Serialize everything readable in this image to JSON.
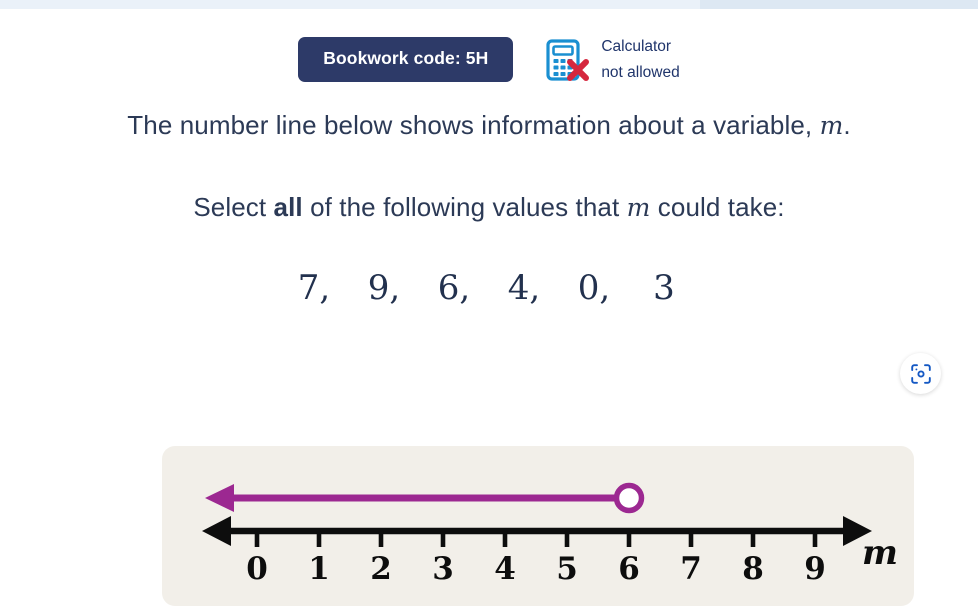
{
  "header": {
    "bookwork_label": "Bookwork code: 5H",
    "calculator_icon": "calculator-not-allowed-icon",
    "calculator_line1": "Calculator",
    "calculator_line2": "not allowed",
    "badge_color": "#2d3a68",
    "calc_icon_color": "#1a8fd1",
    "calc_cross_color": "#d5273e"
  },
  "question": {
    "line1_before": "The number line below shows information about a variable,",
    "line1_var": "m",
    "line1_after": ".",
    "line2_a": "Select",
    "line2_bold": "all",
    "line2_b": "of the following values that",
    "line2_var": "m",
    "line2_c": "could take:"
  },
  "values": [
    {
      "text": "7,"
    },
    {
      "text": "9,"
    },
    {
      "text": "6,"
    },
    {
      "text": "4,"
    },
    {
      "text": "0,"
    },
    {
      "text": "3"
    }
  ],
  "scan_button": {
    "icon": "scan-camera-icon",
    "color": "#1559c4"
  },
  "chart_data": {
    "type": "number-line",
    "title": "",
    "xlabel": "m",
    "tick_labels": [
      "0",
      "1",
      "2",
      "3",
      "4",
      "5",
      "6",
      "7",
      "8",
      "9"
    ],
    "axis_min": 0,
    "axis_max": 9,
    "axis_color": "#0d0d0d",
    "panel_color": "#f2efe9",
    "inequality": {
      "variable": "m",
      "operator": "<",
      "endpoint": 6,
      "endpoint_type": "open",
      "direction": "left",
      "ray_color": "#9c2891",
      "circle_fill": "#ffffff"
    },
    "arrows_both_ends": true,
    "grid": false,
    "legend": "none"
  }
}
